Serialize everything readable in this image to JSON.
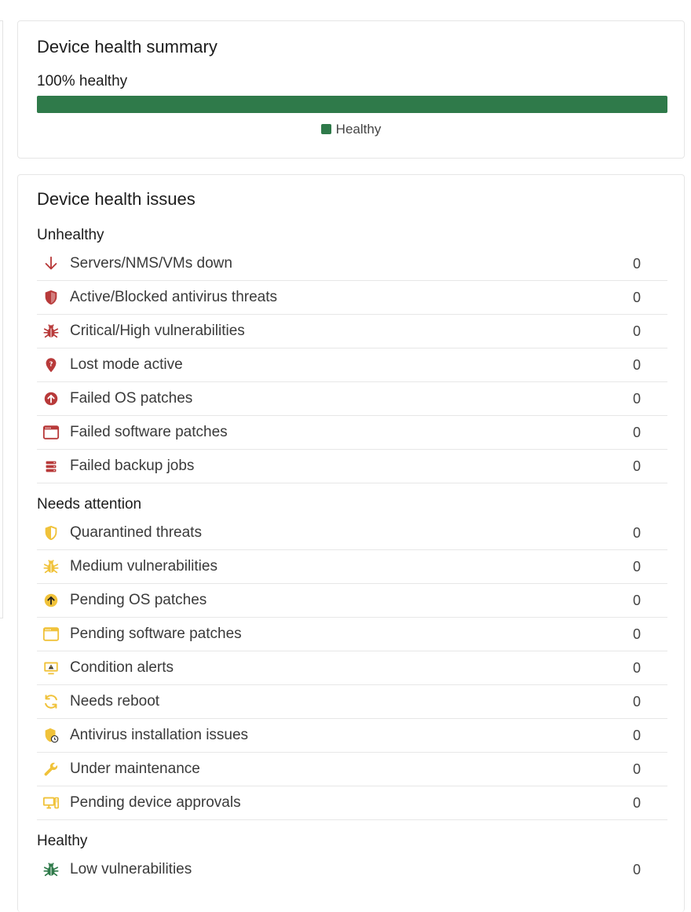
{
  "summary": {
    "title": "Device health summary",
    "healthy_text": "100% healthy",
    "healthy_fraction": 1.0,
    "legend_label": "Healthy"
  },
  "issues": {
    "title": "Device health issues",
    "unhealthy": {
      "label": "Unhealthy",
      "items": [
        {
          "label": "Servers/NMS/VMs down",
          "count": "0",
          "icon": "arrow-down-icon"
        },
        {
          "label": "Active/Blocked antivirus threats",
          "count": "0",
          "icon": "shield-icon"
        },
        {
          "label": "Critical/High vulnerabilities",
          "count": "0",
          "icon": "bug-icon"
        },
        {
          "label": "Lost mode active",
          "count": "0",
          "icon": "location-question-icon"
        },
        {
          "label": "Failed OS patches",
          "count": "0",
          "icon": "arrow-up-circle-icon"
        },
        {
          "label": "Failed software patches",
          "count": "0",
          "icon": "app-window-icon"
        },
        {
          "label": "Failed backup jobs",
          "count": "0",
          "icon": "server-stack-icon"
        }
      ]
    },
    "attention": {
      "label": "Needs attention",
      "items": [
        {
          "label": "Quarantined threats",
          "count": "0",
          "icon": "shield-half-icon"
        },
        {
          "label": "Medium vulnerabilities",
          "count": "0",
          "icon": "bug-icon"
        },
        {
          "label": "Pending OS patches",
          "count": "0",
          "icon": "arrow-up-circle-icon"
        },
        {
          "label": "Pending software patches",
          "count": "0",
          "icon": "app-window-icon"
        },
        {
          "label": "Condition alerts",
          "count": "0",
          "icon": "monitor-warning-icon"
        },
        {
          "label": "Needs reboot",
          "count": "0",
          "icon": "refresh-icon"
        },
        {
          "label": "Antivirus installation issues",
          "count": "0",
          "icon": "shield-clock-icon"
        },
        {
          "label": "Under maintenance",
          "count": "0",
          "icon": "wrench-icon"
        },
        {
          "label": "Pending device approvals",
          "count": "0",
          "icon": "monitor-device-icon"
        }
      ]
    },
    "healthy": {
      "label": "Healthy",
      "items": [
        {
          "label": "Low vulnerabilities",
          "count": "0",
          "icon": "bug-icon"
        }
      ]
    }
  },
  "colors": {
    "healthy_green": "#2f7a4a",
    "unhealthy_red": "#b83a3a",
    "attention_yellow": "#f0c23a"
  }
}
